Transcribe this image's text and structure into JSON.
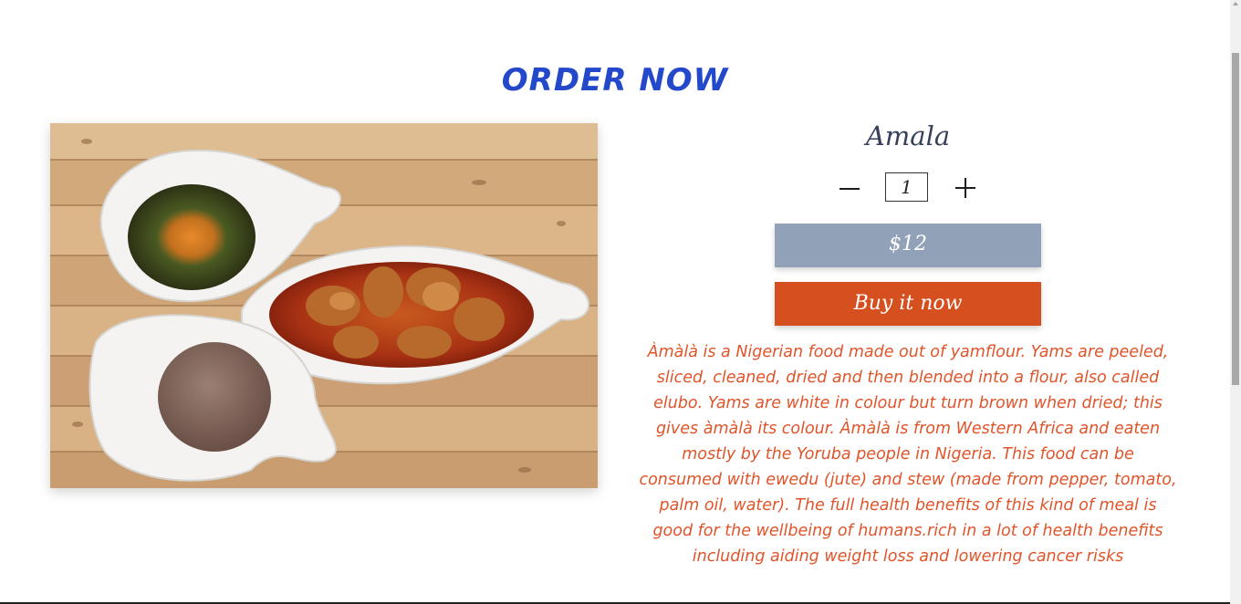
{
  "header": {
    "title": "ORDER NOW"
  },
  "product": {
    "name": "Amala",
    "quantity": "1",
    "price": "$12",
    "buy_label": "Buy it now",
    "description": "Àmàlà is a Nigerian food made out of yamflour. Yams are peeled, sliced, cleaned, dried and then blended into a flour, also called elubo. Yams are white in colour but turn brown when dried; this gives àmàlà its colour. Àmàlà is from Western Africa and eaten mostly by the Yoruba people in Nigeria. This food can be consumed with ewedu (jute) and stew (made from pepper, tomato, palm oil, water). The full health benefits of this kind of meal is good for the wellbeing of humans.rich in a lot of health benefits including aiding weight loss and lowering cancer risks"
  },
  "icons": {
    "minus": "minus-icon",
    "plus": "plus-icon"
  },
  "colors": {
    "title": "#2348c9",
    "price_bg": "#91a1b8",
    "buy_bg": "#d6501f",
    "description": "#e0542a"
  }
}
